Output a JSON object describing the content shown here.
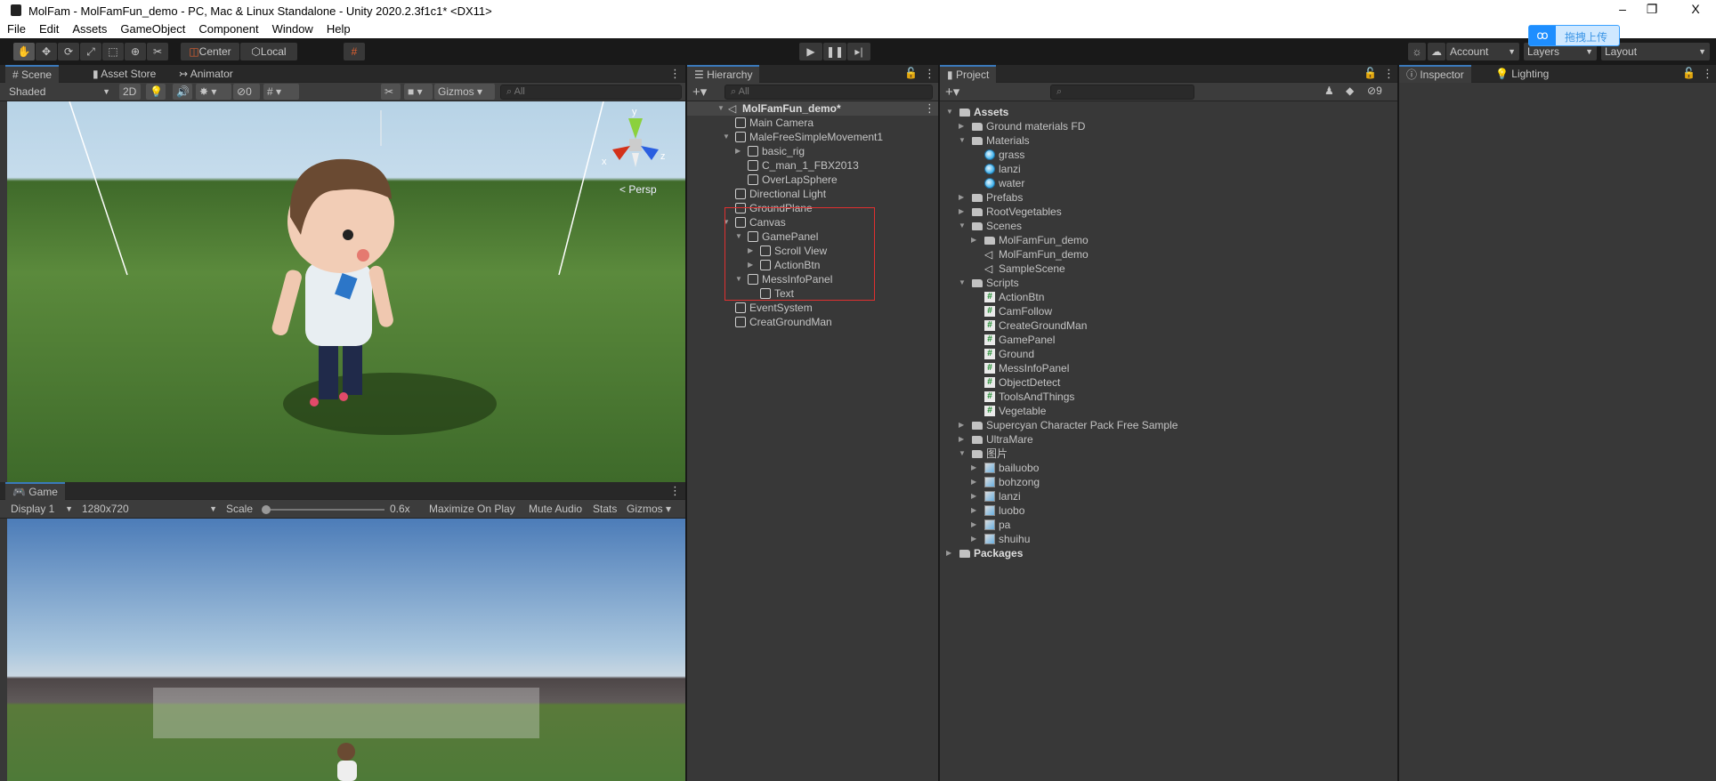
{
  "window": {
    "title": "MolFam - MolFamFun_demo - PC, Mac & Linux Standalone - Unity 2020.2.3f1c1* <DX11>",
    "minimize": "–",
    "restore": "❐",
    "close": "X"
  },
  "menu": [
    "File",
    "Edit",
    "Assets",
    "GameObject",
    "Component",
    "Window",
    "Help"
  ],
  "upload_widget": {
    "label": "拖拽上传",
    "icon": "baidu-cloud-icon"
  },
  "toolbar": {
    "tools": [
      "hand-tool",
      "move-tool",
      "rotate-tool",
      "scale-tool",
      "rect-tool",
      "transform-tool",
      "custom-tool"
    ],
    "pivot": "Center",
    "space": "Local",
    "account": "Account",
    "layers": "Layers",
    "layout": "Layout"
  },
  "scene_panel": {
    "tabs": [
      "Scene",
      "Asset Store",
      "Animator"
    ],
    "shading": "Shaded",
    "mode_2d": "2D",
    "hidden_count": "0",
    "gizmos": "Gizmos",
    "search_placeholder": "All",
    "persp": "< Persp",
    "axes": {
      "x": "x",
      "y": "y",
      "z": "z"
    }
  },
  "game_panel": {
    "tab": "Game",
    "display": "Display 1",
    "resolution": "1280x720",
    "scale_label": "Scale",
    "scale_value": "0.6x",
    "scale_fraction": 0.0,
    "maximize": "Maximize On Play",
    "mute": "Mute Audio",
    "stats": "Stats",
    "gizmos": "Gizmos"
  },
  "hierarchy": {
    "tab": "Hierarchy",
    "search_placeholder": "All",
    "scene": "MolFamFun_demo*",
    "items": [
      {
        "label": "Main Camera",
        "depth": 1,
        "arrow": ""
      },
      {
        "label": "MaleFreeSimpleMovement1",
        "depth": 1,
        "arrow": "down"
      },
      {
        "label": "basic_rig",
        "depth": 2,
        "arrow": "right"
      },
      {
        "label": "C_man_1_FBX2013",
        "depth": 2,
        "arrow": ""
      },
      {
        "label": "OverLapSphere",
        "depth": 2,
        "arrow": ""
      },
      {
        "label": "Directional Light",
        "depth": 1,
        "arrow": ""
      },
      {
        "label": "GroundPlane",
        "depth": 1,
        "arrow": ""
      },
      {
        "label": "Canvas",
        "depth": 1,
        "arrow": "down"
      },
      {
        "label": "GamePanel",
        "depth": 2,
        "arrow": "down"
      },
      {
        "label": "Scroll View",
        "depth": 3,
        "arrow": "right"
      },
      {
        "label": "ActionBtn",
        "depth": 3,
        "arrow": "right"
      },
      {
        "label": "MessInfoPanel",
        "depth": 2,
        "arrow": "down"
      },
      {
        "label": "Text",
        "depth": 3,
        "arrow": ""
      },
      {
        "label": "EventSystem",
        "depth": 1,
        "arrow": ""
      },
      {
        "label": "CreatGroundMan",
        "depth": 1,
        "arrow": ""
      }
    ],
    "highlight_color": "#e03030"
  },
  "project": {
    "tab": "Project",
    "hidden_count": "9",
    "items": [
      {
        "label": "Assets",
        "depth": 0,
        "arrow": "down",
        "icon": "folder-open",
        "bold": true
      },
      {
        "label": "Ground materials FD",
        "depth": 1,
        "arrow": "right",
        "icon": "folder"
      },
      {
        "label": "Materials",
        "depth": 1,
        "arrow": "down",
        "icon": "folder-open"
      },
      {
        "label": "grass",
        "depth": 2,
        "arrow": "",
        "icon": "material"
      },
      {
        "label": "lanzi",
        "depth": 2,
        "arrow": "",
        "icon": "material"
      },
      {
        "label": "water",
        "depth": 2,
        "arrow": "",
        "icon": "material"
      },
      {
        "label": "Prefabs",
        "depth": 1,
        "arrow": "right",
        "icon": "folder"
      },
      {
        "label": "RootVegetables",
        "depth": 1,
        "arrow": "right",
        "icon": "folder"
      },
      {
        "label": "Scenes",
        "depth": 1,
        "arrow": "down",
        "icon": "folder-open"
      },
      {
        "label": "MolFamFun_demo",
        "depth": 2,
        "arrow": "right",
        "icon": "folder"
      },
      {
        "label": "MolFamFun_demo",
        "depth": 2,
        "arrow": "",
        "icon": "scene"
      },
      {
        "label": "SampleScene",
        "depth": 2,
        "arrow": "",
        "icon": "scene"
      },
      {
        "label": "Scripts",
        "depth": 1,
        "arrow": "down",
        "icon": "folder-open"
      },
      {
        "label": "ActionBtn",
        "depth": 2,
        "arrow": "",
        "icon": "script"
      },
      {
        "label": "CamFollow",
        "depth": 2,
        "arrow": "",
        "icon": "script"
      },
      {
        "label": "CreateGroundMan",
        "depth": 2,
        "arrow": "",
        "icon": "script"
      },
      {
        "label": "GamePanel",
        "depth": 2,
        "arrow": "",
        "icon": "script"
      },
      {
        "label": "Ground",
        "depth": 2,
        "arrow": "",
        "icon": "script"
      },
      {
        "label": "MessInfoPanel",
        "depth": 2,
        "arrow": "",
        "icon": "script"
      },
      {
        "label": "ObjectDetect",
        "depth": 2,
        "arrow": "",
        "icon": "script"
      },
      {
        "label": "ToolsAndThings",
        "depth": 2,
        "arrow": "",
        "icon": "script"
      },
      {
        "label": "Vegetable",
        "depth": 2,
        "arrow": "",
        "icon": "script"
      },
      {
        "label": "Supercyan Character Pack Free Sample",
        "depth": 1,
        "arrow": "right",
        "icon": "folder"
      },
      {
        "label": "UltraMare",
        "depth": 1,
        "arrow": "right",
        "icon": "folder"
      },
      {
        "label": "图片",
        "depth": 1,
        "arrow": "down",
        "icon": "folder-open"
      },
      {
        "label": "bailuobo",
        "depth": 2,
        "arrow": "right",
        "icon": "texture"
      },
      {
        "label": "bohzong",
        "depth": 2,
        "arrow": "right",
        "icon": "texture"
      },
      {
        "label": "lanzi",
        "depth": 2,
        "arrow": "right",
        "icon": "texture"
      },
      {
        "label": "luobo",
        "depth": 2,
        "arrow": "right",
        "icon": "texture"
      },
      {
        "label": "pa",
        "depth": 2,
        "arrow": "right",
        "icon": "texture"
      },
      {
        "label": "shuihu",
        "depth": 2,
        "arrow": "right",
        "icon": "texture"
      },
      {
        "label": "Packages",
        "depth": 0,
        "arrow": "right",
        "icon": "folder",
        "bold": true
      }
    ]
  },
  "inspector": {
    "tabs": [
      "Inspector",
      "Lighting"
    ]
  },
  "colors": {
    "accent": "#3a79bb",
    "panel": "#383838",
    "toolbar": "#191919"
  }
}
